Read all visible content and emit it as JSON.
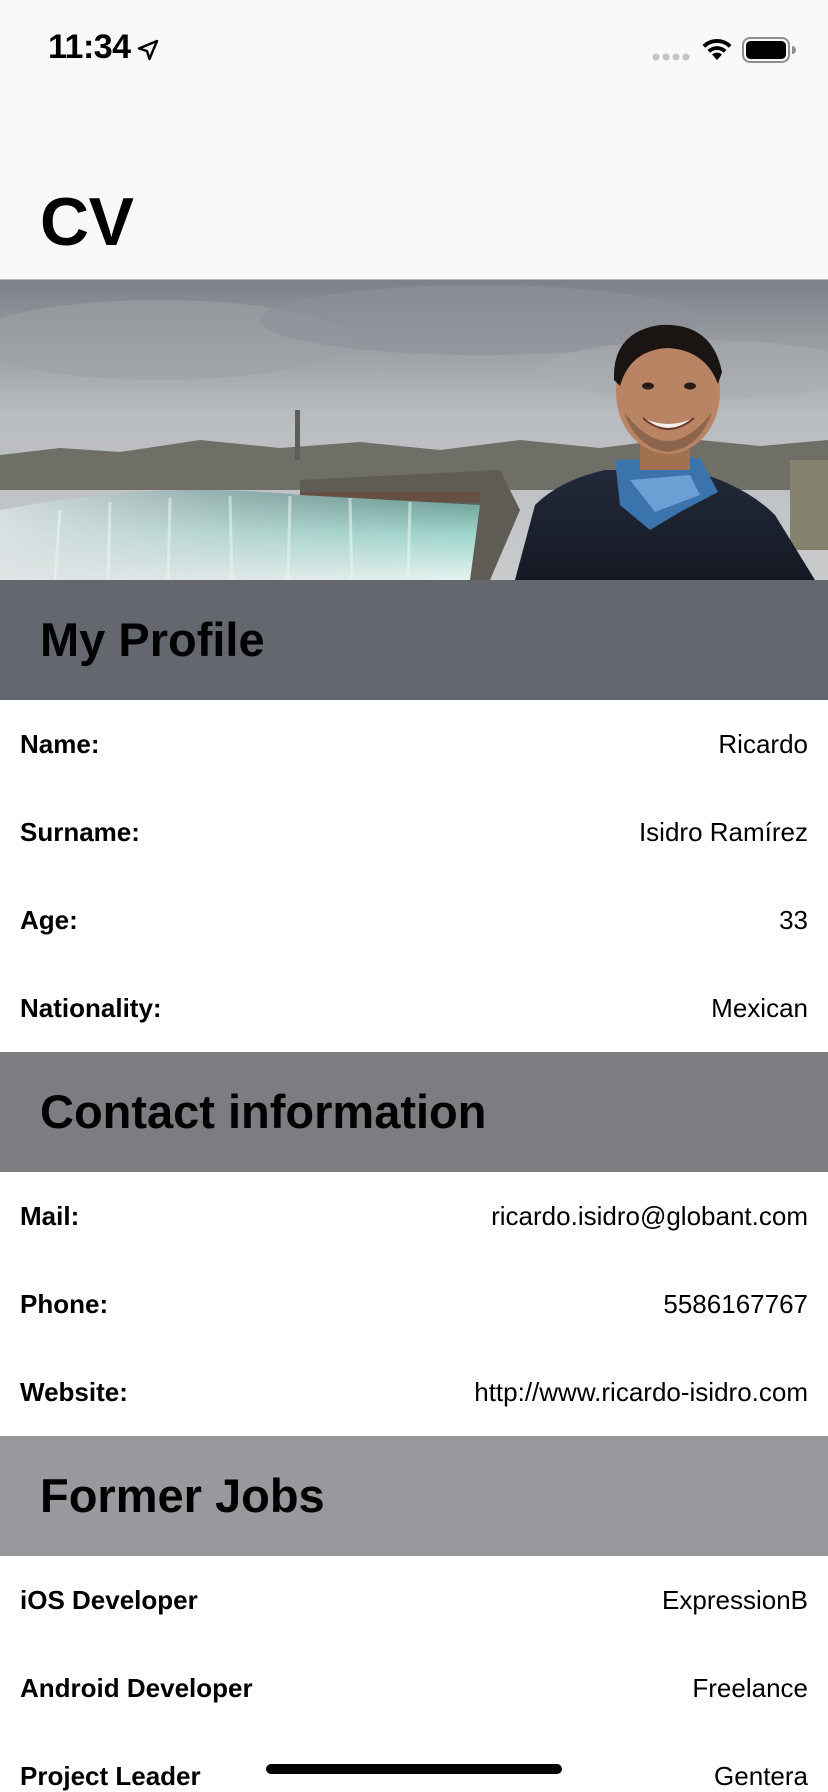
{
  "status_bar": {
    "time": "11:34",
    "icons": [
      "location-arrow-icon",
      "cellular-signal-icon",
      "wifi-icon",
      "battery-icon"
    ]
  },
  "nav": {
    "title": "CV"
  },
  "colors": {
    "profile_header": "#65676f",
    "contact_header": "#7d7c81",
    "jobs_header": "#98989d",
    "nav_background": "#f8f8f8"
  },
  "sections": {
    "profile": {
      "title": "My Profile",
      "rows": [
        {
          "label": "Name:",
          "value": "Ricardo"
        },
        {
          "label": "Surname:",
          "value": "Isidro Ramírez"
        },
        {
          "label": "Age:",
          "value": "33"
        },
        {
          "label": "Nationality:",
          "value": "Mexican"
        }
      ]
    },
    "contact": {
      "title": "Contact information",
      "rows": [
        {
          "label": "Mail:",
          "value": "ricardo.isidro@globant.com"
        },
        {
          "label": "Phone:",
          "value": "5586167767"
        },
        {
          "label": "Website:",
          "value": "http://www.ricardo-isidro.com"
        }
      ]
    },
    "jobs": {
      "title": "Former Jobs",
      "rows": [
        {
          "label": "iOS Developer",
          "value": "ExpressionB"
        },
        {
          "label": "Android Developer",
          "value": "Freelance"
        },
        {
          "label": "Project Leader",
          "value": "Gentera"
        }
      ]
    }
  }
}
